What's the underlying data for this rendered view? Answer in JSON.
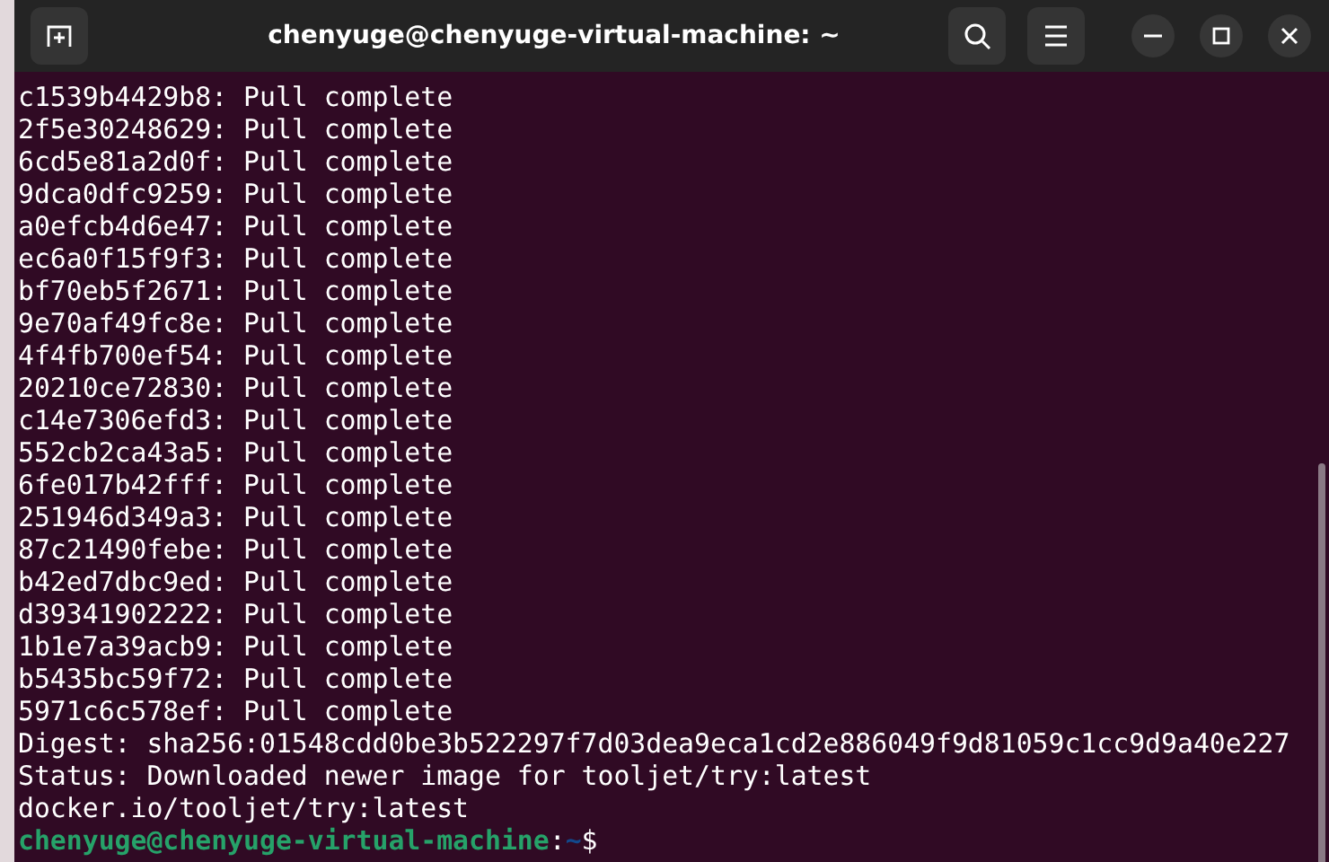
{
  "window": {
    "title": "chenyuge@chenyuge-virtual-machine: ~"
  },
  "terminal": {
    "lines": [
      "c1539b4429b8: Pull complete",
      "2f5e30248629: Pull complete",
      "6cd5e81a2d0f: Pull complete",
      "9dca0dfc9259: Pull complete",
      "a0efcb4d6e47: Pull complete",
      "ec6a0f15f9f3: Pull complete",
      "bf70eb5f2671: Pull complete",
      "9e70af49fc8e: Pull complete",
      "4f4fb700ef54: Pull complete",
      "20210ce72830: Pull complete",
      "c14e7306efd3: Pull complete",
      "552cb2ca43a5: Pull complete",
      "6fe017b42fff: Pull complete",
      "251946d349a3: Pull complete",
      "87c21490febe: Pull complete",
      "b42ed7dbc9ed: Pull complete",
      "d39341902222: Pull complete",
      "1b1e7a39acb9: Pull complete",
      "b5435bc59f72: Pull complete",
      "5971c6c578ef: Pull complete",
      "Digest: sha256:01548cdd0be3b522297f7d03dea9eca1cd2e886049f9d81059c1cc9d9a40e227",
      "Status: Downloaded newer image for tooljet/try:latest",
      "docker.io/tooljet/try:latest"
    ],
    "prompt": {
      "user_host": "chenyuge@chenyuge-virtual-machine",
      "separator": ":",
      "path": "~",
      "symbol": "$"
    }
  }
}
